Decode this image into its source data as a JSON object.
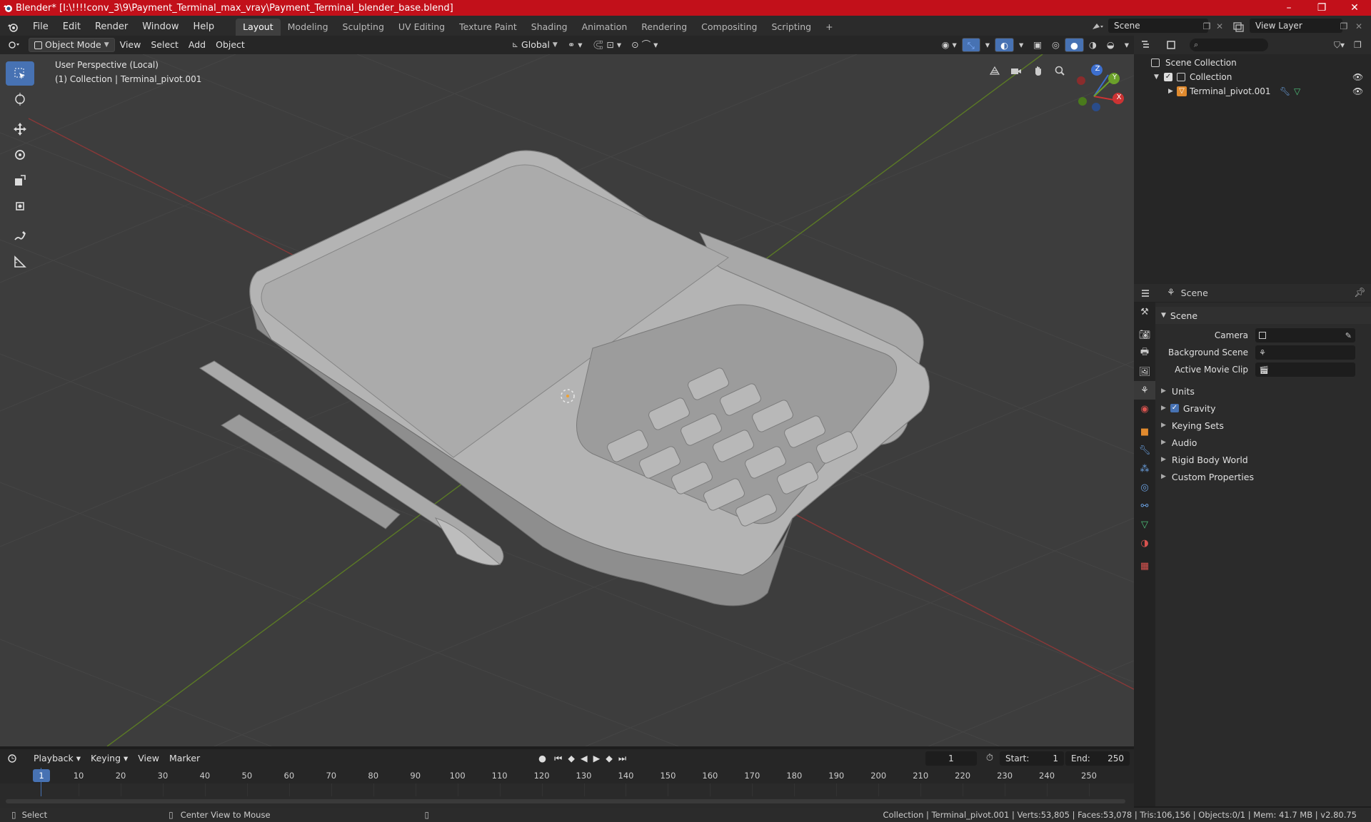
{
  "window": {
    "title": "Blender* [I:\\!!!!conv_3\\9\\Payment_Terminal_max_vray\\Payment_Terminal_blender_base.blend]",
    "minimize": "–",
    "maximize": "❐",
    "close": "✕"
  },
  "menu": [
    "File",
    "Edit",
    "Render",
    "Window",
    "Help"
  ],
  "workspaces": [
    "Layout",
    "Modeling",
    "Sculpting",
    "UV Editing",
    "Texture Paint",
    "Shading",
    "Animation",
    "Rendering",
    "Compositing",
    "Scripting"
  ],
  "workspace_add": "+",
  "scene_name": "Scene",
  "view_layer": "View Layer",
  "viewport_header": {
    "mode": "Object Mode",
    "view": "View",
    "select": "Select",
    "add": "Add",
    "object": "Object",
    "orientation": "Global"
  },
  "viewport": {
    "perspective": "User Perspective (Local)",
    "collection_info": "(1) Collection | Terminal_pivot.001",
    "axes": {
      "x": "X",
      "y": "Y",
      "z": "Z"
    }
  },
  "outliner": {
    "root": "Scene Collection",
    "collection": "Collection",
    "object": "Terminal_pivot.001"
  },
  "properties": {
    "header": "Scene",
    "panel": "Scene",
    "camera_label": "Camera",
    "background_label": "Background Scene",
    "movieclip_label": "Active Movie Clip",
    "sections": [
      "Units",
      "Gravity",
      "Keying Sets",
      "Audio",
      "Rigid Body World",
      "Custom Properties"
    ]
  },
  "timeline": {
    "playback": "Playback",
    "keying": "Keying",
    "view": "View",
    "marker": "Marker",
    "current_frame": "1",
    "start_label": "Start:",
    "start": "1",
    "end_label": "End:",
    "end": "250",
    "ticks": [
      "1",
      "10",
      "20",
      "30",
      "40",
      "50",
      "60",
      "70",
      "80",
      "90",
      "100",
      "110",
      "120",
      "130",
      "140",
      "150",
      "160",
      "170",
      "180",
      "190",
      "200",
      "210",
      "220",
      "230",
      "240",
      "250"
    ]
  },
  "status": {
    "select": "Select",
    "center": "Center View to Mouse",
    "stats": "Collection | Terminal_pivot.001 | Verts:53,805 | Faces:53,078 | Tris:106,156 | Objects:0/1 | Mem: 41.7 MB | v2.80.75"
  }
}
